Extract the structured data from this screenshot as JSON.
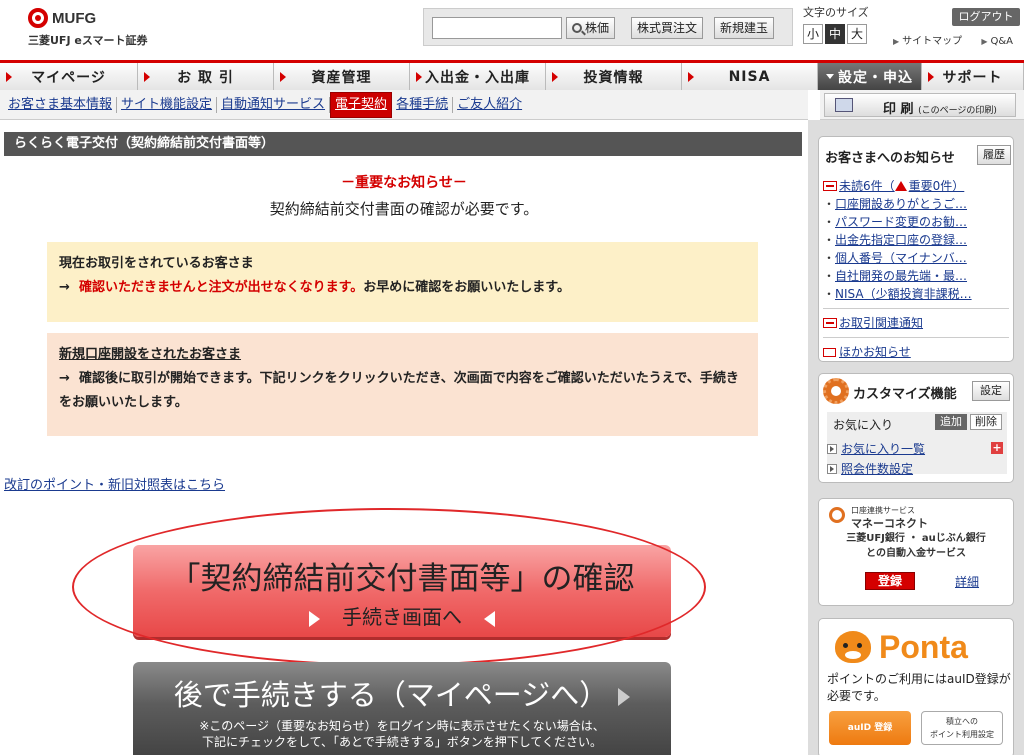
{
  "header": {
    "logo_text": "MUFG",
    "logo_sub": "三菱UFJ eスマート証券",
    "search_placeholder": "",
    "search_buttons": [
      "株価",
      "株式買注文",
      "新規建玉"
    ],
    "fontsize_label": "文字のサイズ",
    "fontsize_options": [
      "小",
      "中",
      "大"
    ],
    "fontsize_selected": "中",
    "logout_label": "ログアウト",
    "sitemap_label": "サイトマップ",
    "qa_label": "Q&A"
  },
  "nav": {
    "items": [
      "マイページ",
      "お 取 引",
      "資産管理",
      "入出金・入出庫",
      "投資情報",
      "NISA",
      "設定・申込",
      "サポート"
    ]
  },
  "subnav": {
    "items": [
      "お客さま基本情報",
      "サイト機能設定",
      "自動通知サービス",
      "電子契約",
      "各種手続",
      "ご友人紹介"
    ],
    "active": "電子契約"
  },
  "print": {
    "label": "印 刷",
    "sub": "(このページの印刷)"
  },
  "main": {
    "heading": "らくらく電子交付（契約締結前交付書面等）",
    "notice_title": "－重要なお知らせ－",
    "notice_body": "契約締結前交付書面の確認が必要です。",
    "box1": {
      "title": "現在お取引をされているお客さま",
      "arrow": "→",
      "red": "確認いただきませんと注文が出せなくなります。",
      "rest": "お早めに確認をお願いいたします。"
    },
    "box2": {
      "title": "新規口座開設をされたお客さま",
      "arrow": "→",
      "text": "確認後に取引が開始できます。下記リンクをクリックいただき、次画面で内容をご確認いただいたうえで、手続きをお願いいたします。"
    },
    "revision_link": "改訂のポイント・新旧対照表はこちら",
    "confirm_button": {
      "main": "「契約締結前交付書面等」の確認",
      "sub": "手続き画面へ"
    },
    "later_button": {
      "main": "後で手続きする（マイページへ）",
      "note1": "※このページ（重要なお知らせ）をログイン時に表示させたくない場合は、",
      "note2": "下記にチェックをして、「あとで手続きする」ボタンを押下してください。"
    }
  },
  "sidebar": {
    "notices": {
      "title": "お客さまへのお知らせ",
      "history_label": "履歴",
      "unread": "未読6件（",
      "important": "重要0件）",
      "items": [
        "口座開設ありがとうご…",
        "パスワード変更のお勧…",
        "出金先指定口座の登録…",
        "個人番号（マイナンバ…",
        "自社開発の最先端・最…",
        "NISA（少額投資非課税…"
      ],
      "trade_notice": "お取引関連通知",
      "other_notice": "ほかお知らせ"
    },
    "customize": {
      "title": "カスタマイズ機能",
      "settings_label": "設定",
      "favorites_label": "お気に入り",
      "add_label": "追加",
      "delete_label": "削除",
      "favorites_list": "お気に入り一覧",
      "inquiry_settings": "照会件数設定"
    },
    "money_connect": {
      "small": "口座連携サービス",
      "title": "マネーコネクト",
      "desc1": "三菱UFJ銀行 ・ auじぶん銀行",
      "desc2": "との自動入金サービス",
      "login_label": "登録",
      "detail_label": "詳細"
    },
    "ponta": {
      "logo": "Ponta",
      "text": "ポイントのご利用にはauID登録が必要です。",
      "auid_label": "auID 登録",
      "point_label1": "積立への",
      "point_label2": "ポイント利用設定"
    }
  },
  "colors": {
    "brand_red": "#d40000",
    "link": "#1a3a8f"
  }
}
